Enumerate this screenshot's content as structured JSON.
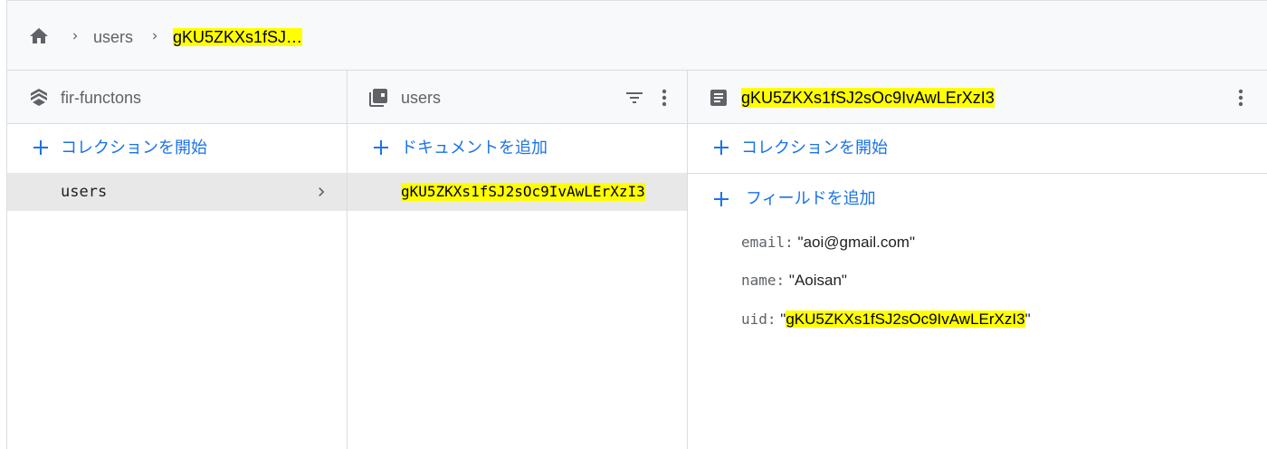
{
  "breadcrumb": {
    "home_icon": "home-icon",
    "items": [
      "users",
      "gKU5ZKXs1fSJ…"
    ]
  },
  "root_panel": {
    "title": "fir-functons",
    "icon": "firestore-stack-icon",
    "add_collection_label": "コレクションを開始",
    "items": [
      {
        "label": "users",
        "selected": true
      }
    ]
  },
  "collection_panel": {
    "title": "users",
    "icon": "collection-icon",
    "add_document_label": "ドキュメントを追加",
    "items": [
      {
        "label": "gKU5ZKXs1fSJ2sOc9IvAwLErXzI3",
        "selected": true
      }
    ]
  },
  "document_panel": {
    "title": "gKU5ZKXs1fSJ2sOc9IvAwLErXzI3",
    "icon": "document-icon",
    "add_collection_label": "コレクションを開始",
    "add_field_label": "フィールドを追加",
    "fields": [
      {
        "key": "email:",
        "value": "\"aoi@gmail.com\""
      },
      {
        "key": "name:",
        "value": "\"Aoisan\""
      },
      {
        "key": "uid:",
        "value_prefix": "\"",
        "value_highlight": "gKU5ZKXs1fSJ2sOc9IvAwLErXzI3",
        "value_suffix": "\""
      }
    ]
  },
  "colors": {
    "accent": "#1a73e8",
    "highlight": "#ffff00",
    "selected_row": "#e8e8e8",
    "header_bg": "#f8f9fa"
  }
}
